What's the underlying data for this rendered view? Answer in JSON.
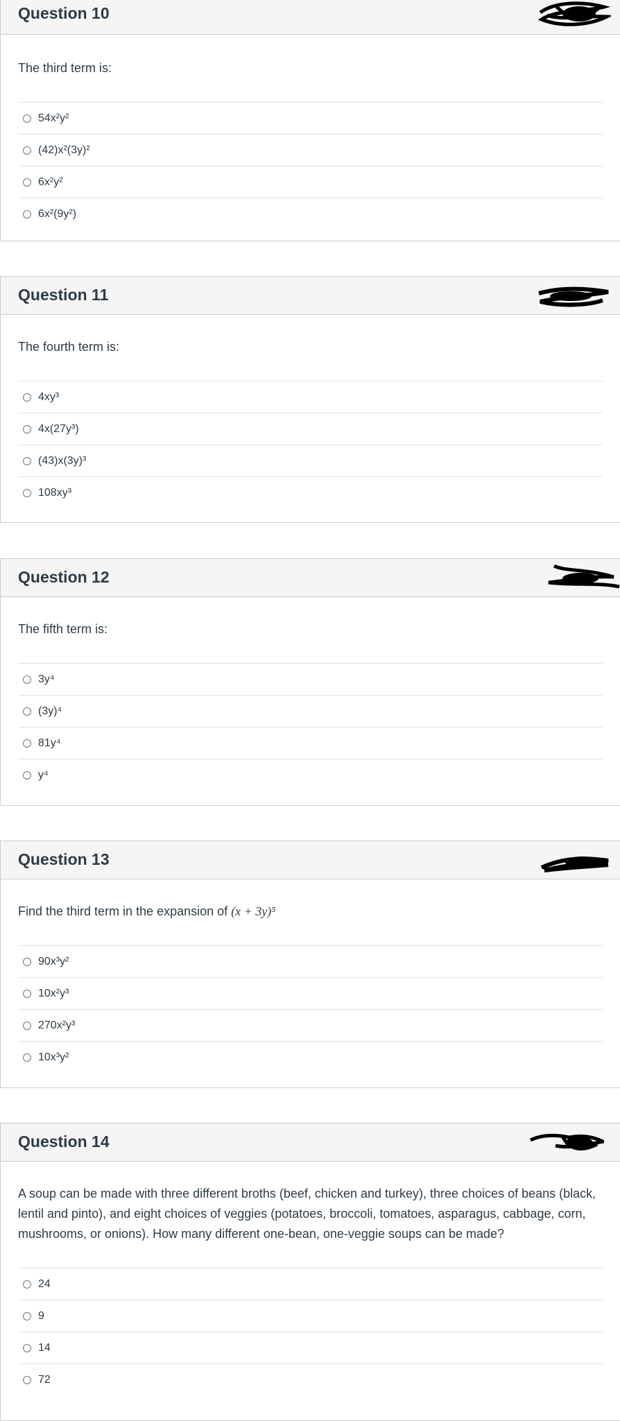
{
  "questions": [
    {
      "title": "Question 10",
      "prompt": "The third term is:",
      "answers": [
        "54x²y²",
        "(42)x²(3y)²",
        "6x²y²",
        "6x²(9y²)"
      ]
    },
    {
      "title": "Question 11",
      "prompt": "The fourth term is:",
      "answers": [
        "4xy³",
        "4x(27y³)",
        "(43)x(3y)³",
        "108xy³"
      ]
    },
    {
      "title": "Question 12",
      "prompt": "The fifth term is:",
      "answers": [
        "3y⁴",
        "(3y)⁴",
        "81y⁴",
        "y⁴"
      ]
    },
    {
      "title": "Question 13",
      "prompt": "Find the third term in the expansion of",
      "prompt_math": "(x + 3y)⁵",
      "answers": [
        "90x³y²",
        "10x²y³",
        "270x²y³",
        "10x³y²"
      ]
    },
    {
      "title": "Question 14",
      "prompt": "A soup can be made with three different broths (beef, chicken and turkey), three choices of beans (black, lentil and pinto), and eight choices of veggies (potatoes, broccoli, tomatoes, asparagus, cabbage, corn, mushrooms, or onions). How many different one-bean, one-veggie soups can be made?",
      "answers": [
        "24",
        "9",
        "14",
        "72"
      ]
    }
  ],
  "colors": {
    "header_bg": "#f5f5f5",
    "border": "#c7cdd1",
    "text": "#2d3b45",
    "scribble": "#000000"
  }
}
